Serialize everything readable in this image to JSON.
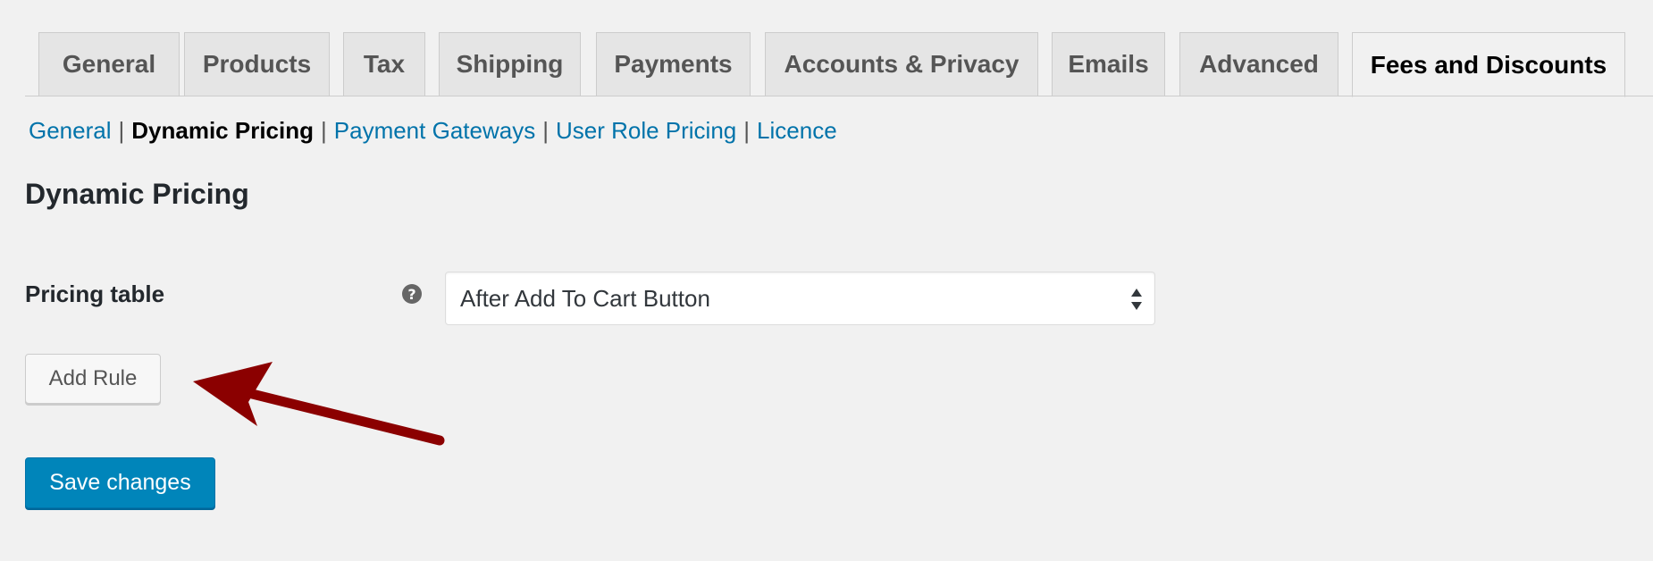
{
  "tabs": [
    {
      "label": "General"
    },
    {
      "label": "Products"
    },
    {
      "label": "Tax"
    },
    {
      "label": "Shipping"
    },
    {
      "label": "Payments"
    },
    {
      "label": "Accounts & Privacy"
    },
    {
      "label": "Emails"
    },
    {
      "label": "Advanced"
    },
    {
      "label": "Fees and Discounts",
      "active": true
    }
  ],
  "subnav": {
    "items": [
      {
        "label": "General"
      },
      {
        "label": "Dynamic Pricing",
        "current": true
      },
      {
        "label": "Payment Gateways"
      },
      {
        "label": "User Role Pricing"
      },
      {
        "label": "Licence"
      }
    ],
    "separator": "|"
  },
  "section_title": "Dynamic Pricing",
  "pricing_table": {
    "label": "Pricing table",
    "help_icon": "question-circle-icon",
    "help_glyph": "?",
    "selected_value": "After Add To Cart Button"
  },
  "buttons": {
    "add_rule": "Add Rule",
    "save_changes": "Save changes"
  },
  "colors": {
    "link": "#0073aa",
    "primary_button": "#0085ba",
    "arrow": "#8b0000",
    "background": "#f1f1f1"
  }
}
